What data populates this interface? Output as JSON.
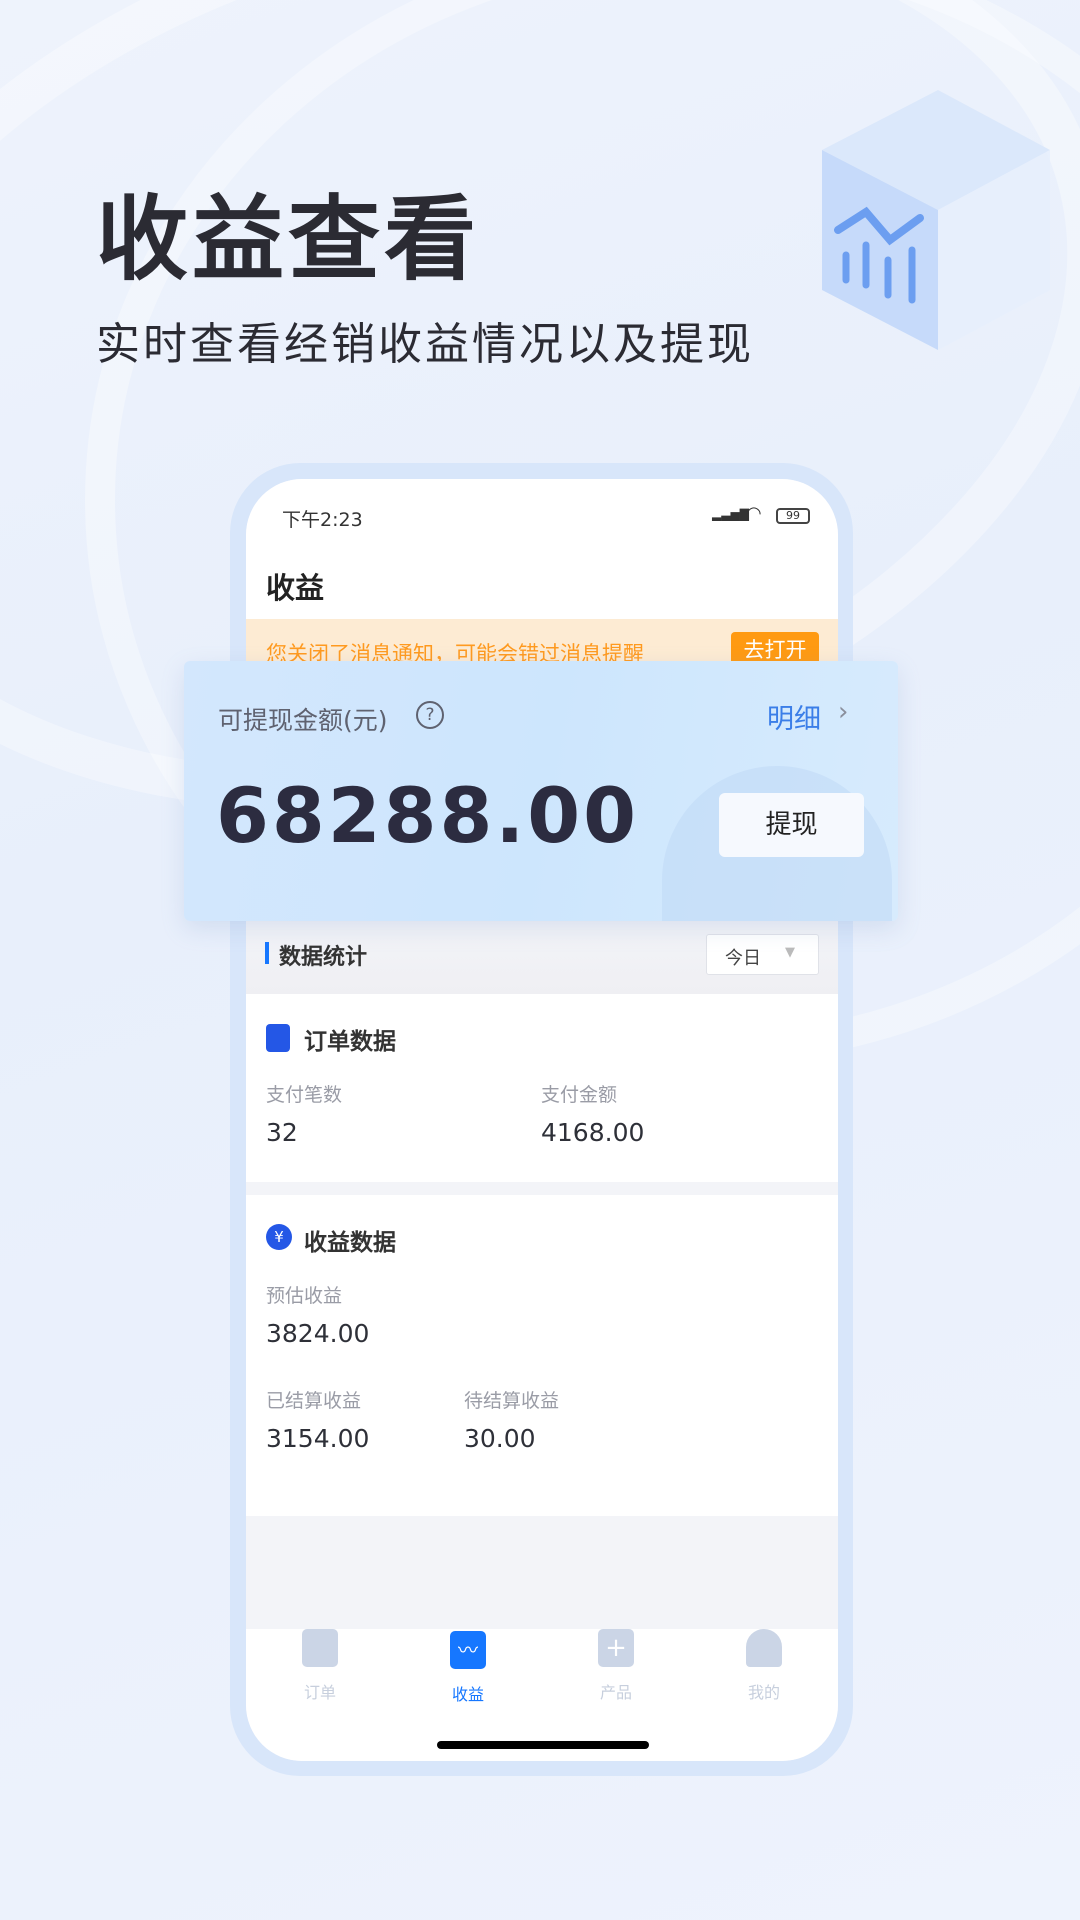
{
  "hero": {
    "title": "收益查看",
    "subtitle": "实时查看经销收益情况以及提现"
  },
  "status_bar": {
    "time": "下午2:23",
    "battery": "99"
  },
  "header": {
    "title": "收益"
  },
  "notice": {
    "text": "您关闭了消息通知，可能会错过消息提醒",
    "button": "去打开"
  },
  "balance": {
    "label": "可提现金额(元)",
    "detail_link": "明细",
    "amount": "68288.00",
    "withdraw_button": "提现"
  },
  "stats": {
    "title": "数据统计",
    "period": "今日"
  },
  "orders": {
    "title": "订单数据",
    "items": [
      {
        "label": "支付笔数",
        "value": "32"
      },
      {
        "label": "支付金额",
        "value": "4168.00"
      }
    ]
  },
  "revenue": {
    "title": "收益数据",
    "estimated": {
      "label": "预估收益",
      "value": "3824.00"
    },
    "items": [
      {
        "label": "已结算收益",
        "value": "3154.00"
      },
      {
        "label": "待结算收益",
        "value": "30.00"
      }
    ]
  },
  "tabs": [
    {
      "label": "订单",
      "icon": "document-icon"
    },
    {
      "label": "收益",
      "icon": "chart-icon",
      "active": true
    },
    {
      "label": "产品",
      "icon": "bag-plus-icon"
    },
    {
      "label": "我的",
      "icon": "user-icon"
    }
  ],
  "colors": {
    "accent": "#1677ff",
    "notice_bg": "#fdebd3",
    "notice_text": "#ff9a1f",
    "text": "#2e3038"
  }
}
